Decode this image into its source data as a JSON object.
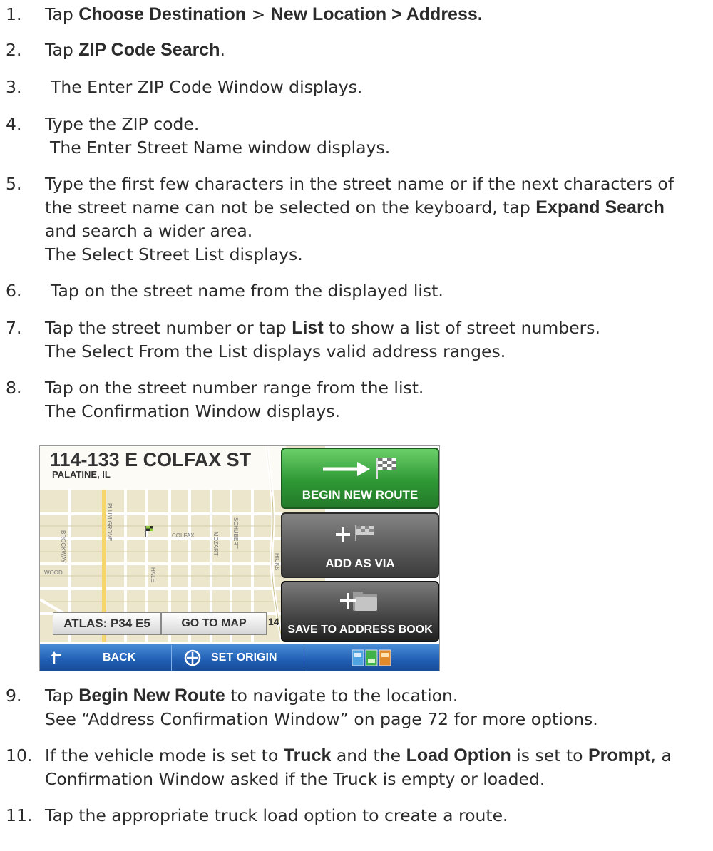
{
  "steps": [
    {
      "num": "1.",
      "lines": [
        [
          {
            "t": "Tap "
          },
          {
            "t": "Choose Destination",
            "b": true
          },
          {
            "t": " > "
          },
          {
            "t": "New Location > Address.",
            "b": true
          }
        ]
      ]
    },
    {
      "num": "2.",
      "lines": [
        [
          {
            "t": "Tap "
          },
          {
            "t": "ZIP Code Search",
            "b": true
          },
          {
            "t": "."
          }
        ]
      ]
    },
    {
      "num": "3.",
      "lines": [
        [
          {
            "t": "The Enter ZIP Code Window displays."
          }
        ]
      ]
    },
    {
      "num": "4.",
      "lines": [
        [
          {
            "t": "Type the ZIP code."
          }
        ],
        [
          {
            "t": "The Enter Street Name window displays."
          }
        ]
      ]
    },
    {
      "num": "5.",
      "lines": [
        [
          {
            "t": "Type the first few characters in the street name or if the next characters of"
          }
        ],
        [
          {
            "t": "the street name can not be selected on the keyboard, tap "
          },
          {
            "t": "Expand Search",
            "b": true
          }
        ],
        [
          {
            "t": "and search a wider area."
          }
        ],
        [
          {
            "t": "The Select Street List displays."
          }
        ]
      ]
    },
    {
      "num": "6.",
      "lines": [
        [
          {
            "t": "Tap on the street name from the displayed list."
          }
        ]
      ]
    },
    {
      "num": "7.",
      "lines": [
        [
          {
            "t": "Tap the street number or tap "
          },
          {
            "t": "List",
            "b": true
          },
          {
            "t": " to show a list of street numbers."
          }
        ],
        [
          {
            "t": "The Select From the List displays valid address ranges."
          }
        ]
      ]
    },
    {
      "num": "8.",
      "lines": [
        [
          {
            "t": "Tap on the street number range from the list."
          }
        ],
        [
          {
            "t": "The Confirmation Window displays."
          }
        ]
      ]
    },
    {
      "num": "9.",
      "lines": [
        [
          {
            "t": "Tap "
          },
          {
            "t": "Begin New Route",
            "b": true
          },
          {
            "t": " to navigate to the location."
          }
        ],
        [
          {
            "t": "See “Address Confirmation Window” on page 72 for more options."
          }
        ]
      ]
    },
    {
      "num": "10.",
      "lines": [
        [
          {
            "t": "If the vehicle mode is set to "
          },
          {
            "t": "Truck",
            "b": true
          },
          {
            "t": " and the "
          },
          {
            "t": "Load Option",
            "b": true
          },
          {
            "t": " is set to "
          },
          {
            "t": "Prompt",
            "b": true
          },
          {
            "t": ", a"
          }
        ],
        [
          {
            "t": "Confirmation Window asked if the Truck is empty or loaded."
          }
        ]
      ]
    },
    {
      "num": "11.",
      "lines": [
        [
          {
            "t": "Tap the appropriate truck load option to create a route."
          }
        ]
      ]
    }
  ],
  "screen": {
    "address": "114-133 E COLFAX ST",
    "city": "PALATINE, IL",
    "atlas": "ATLAS: P34 E5",
    "go_to_map": "GO TO MAP",
    "map_number": "14",
    "street_labels": [
      "BROCKWAY",
      "PLUM GROVE",
      "COLFAX",
      "HALE",
      "WOOD",
      "MOZART",
      "SCHUBERT",
      "HICKS"
    ],
    "begin_new_route": "BEGIN NEW ROUTE",
    "add_as_via": "ADD AS VIA",
    "save_to_address_book": "SAVE TO ADDRESS BOOK",
    "back": "BACK",
    "set_origin": "SET ORIGIN",
    "colors": {
      "begin": "#2e9834",
      "bar": "#1f5db3",
      "map": "#ece6cc",
      "major_road": "#f4d66a"
    }
  }
}
